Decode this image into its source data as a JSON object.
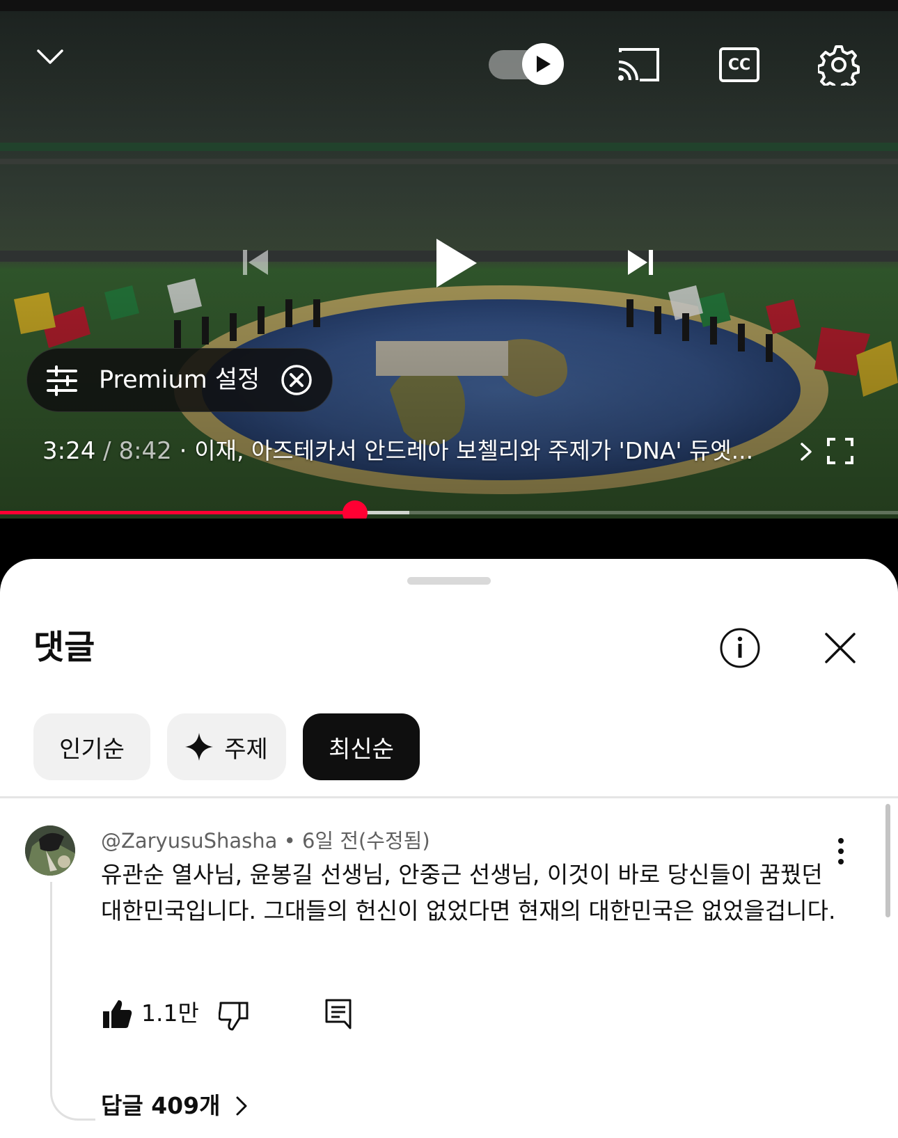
{
  "player": {
    "time_current": "3:24",
    "time_separator": " / ",
    "time_total": "8:42",
    "title_separator": " · ",
    "video_title": "이재, 아즈테카서 안드레아 보첼리와 주제가 'DNA' 듀엣...",
    "progress_fraction": 0.395,
    "premium_chip_label": "Premium 설정",
    "accent_color": "#ff0033",
    "icons": [
      "collapse-chevron-icon",
      "autoplay-toggle-icon",
      "cast-icon",
      "captions-icon",
      "settings-gear-icon",
      "previous-icon",
      "play-icon",
      "next-icon",
      "premium-sliders-icon",
      "close-circle-icon",
      "chevron-right-icon",
      "fullscreen-icon"
    ]
  },
  "captions_label": "CC",
  "comments_sheet": {
    "title": "댓글",
    "chips": [
      {
        "label": "인기순",
        "selected": false
      },
      {
        "label": "주제",
        "selected": false
      },
      {
        "label": "최신순",
        "selected": true
      }
    ],
    "comments": [
      {
        "author": "@ZaryusuShasha",
        "meta_separator": " • ",
        "time": "6일 전(수정됨)",
        "text": "유관순 열사님, 윤봉길 선생님, 안중근 선생님, 이것이 바로 당신들이 꿈꿨던 대한민국입니다. 그대들의 헌신이 없었다면 현재의 대한민국은 없었을겁니다.",
        "likes": "1.1만",
        "replies_label": "답글 409개"
      }
    ]
  }
}
